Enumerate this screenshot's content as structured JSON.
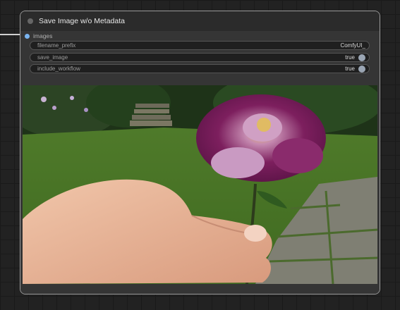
{
  "node": {
    "title": "Save Image w/o Metadata",
    "input": {
      "label": "images"
    },
    "widgets": [
      {
        "label": "filename_prefix",
        "value": "ComfyUI_"
      },
      {
        "label": "save_image",
        "value": "true"
      },
      {
        "label": "include_workflow",
        "value": "true"
      }
    ]
  },
  "colors": {
    "input_slot": "#7ab4f0",
    "node_border": "#9a9a9a",
    "canvas": "#222222"
  }
}
